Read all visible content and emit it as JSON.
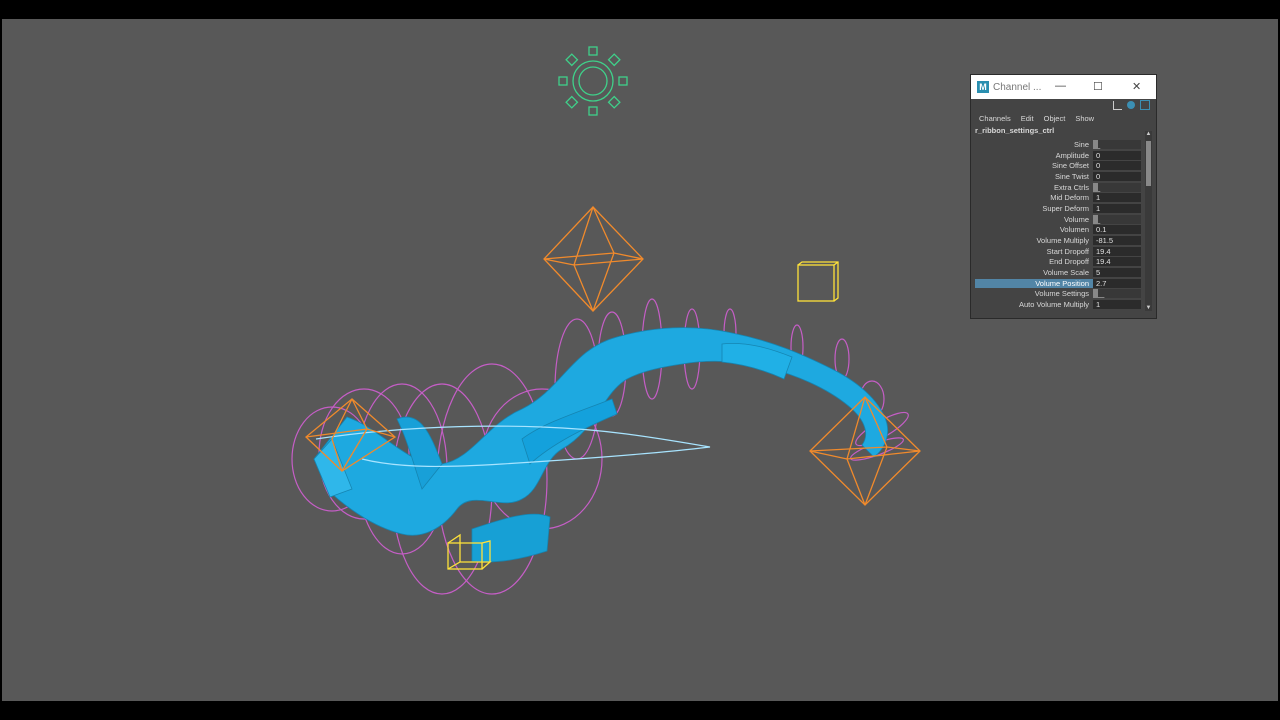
{
  "window": {
    "minimize_icon": "minimize-icon",
    "restore_icon": "restore-icon",
    "close_icon": "close-icon"
  },
  "channel_editor": {
    "title": "Channel ...",
    "menu": [
      "Channels",
      "Edit",
      "Object",
      "Show"
    ],
    "object_name": "r_ribbon_settings_ctrl",
    "channels": [
      {
        "label": "Sine",
        "value": "_"
      },
      {
        "label": "Amplitude",
        "value": "0"
      },
      {
        "label": "Sine Offset",
        "value": "0"
      },
      {
        "label": "Sine Twist",
        "value": "0"
      },
      {
        "label": "Extra Ctrls",
        "value": "_"
      },
      {
        "label": "Mid Deform",
        "value": "1"
      },
      {
        "label": "Super Deform",
        "value": "1"
      },
      {
        "label": "Volume",
        "value": "_"
      },
      {
        "label": "Volumen",
        "value": "0.1"
      },
      {
        "label": "Volume Multiply",
        "value": "-81.5"
      },
      {
        "label": "Start Dropoff",
        "value": "19.4"
      },
      {
        "label": "End Dropoff",
        "value": "19.4"
      },
      {
        "label": "Volume Scale",
        "value": "5"
      },
      {
        "label": "Volume Position",
        "value": "2.7",
        "selected": true
      },
      {
        "label": "Volume Settings",
        "value": "__"
      },
      {
        "label": "Auto Volume Multiply",
        "value": "1"
      }
    ],
    "colors": {
      "selected": "#5285a6",
      "panel": "#444444"
    }
  },
  "viewport": {
    "background": "#585858",
    "colors": {
      "ribbon": "#1ea9e0",
      "settings_gear": "#3fd18a",
      "diamond": "#f08a2c",
      "cube": "#ffe23a",
      "circle": "#c55ec6",
      "curve": "#a8e4ff"
    }
  }
}
